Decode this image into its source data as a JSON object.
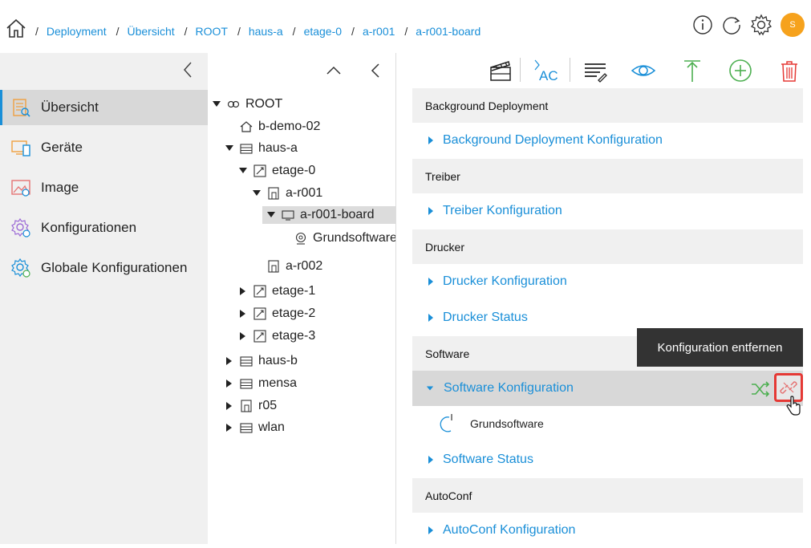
{
  "breadcrumb": [
    "Deployment",
    "Übersicht",
    "ROOT",
    "haus-a",
    "etage-0",
    "a-r001",
    "a-r001-board"
  ],
  "user": {
    "avatar_initial": "S"
  },
  "sidebar": {
    "items": [
      {
        "label": "Übersicht",
        "icon": "overview-icon",
        "active": true
      },
      {
        "label": "Geräte",
        "icon": "devices-icon"
      },
      {
        "label": "Image",
        "icon": "image-icon"
      },
      {
        "label": "Konfigurationen",
        "icon": "config-gear-icon"
      },
      {
        "label": "Globale Konfigurationen",
        "icon": "global-config-icon"
      }
    ]
  },
  "tree": {
    "nodes": [
      {
        "label": "ROOT",
        "icon": "root-icon",
        "expanded": true
      },
      {
        "label": "b-demo-02",
        "icon": "home-icon"
      },
      {
        "label": "haus-a",
        "icon": "building-icon",
        "expanded": true
      },
      {
        "label": "etage-0",
        "icon": "floor-icon",
        "expanded": true
      },
      {
        "label": "a-r001",
        "icon": "room-icon",
        "expanded": true
      },
      {
        "label": "a-r001-board",
        "icon": "board-icon",
        "expanded": true,
        "selected": true
      },
      {
        "label": "Grundsoftware",
        "icon": "software-icon"
      },
      {
        "label": "a-r002",
        "icon": "room-icon"
      },
      {
        "label": "etage-1",
        "icon": "floor-icon",
        "expanded": false
      },
      {
        "label": "etage-2",
        "icon": "floor-icon",
        "expanded": false
      },
      {
        "label": "etage-3",
        "icon": "floor-icon",
        "expanded": false
      },
      {
        "label": "haus-b",
        "icon": "building-icon",
        "expanded": false
      },
      {
        "label": "mensa",
        "icon": "building-icon",
        "expanded": false
      },
      {
        "label": "r05",
        "icon": "room-icon",
        "expanded": false
      },
      {
        "label": "wlan",
        "icon": "building-icon",
        "expanded": false
      }
    ]
  },
  "toolbar": {
    "ac_label": "AC"
  },
  "content": {
    "sections": [
      {
        "header": "Background Deployment",
        "rows": [
          "Background Deployment Konfiguration"
        ]
      },
      {
        "header": "Treiber",
        "rows": [
          "Treiber Konfiguration"
        ]
      },
      {
        "header": "Drucker",
        "rows": [
          "Drucker Konfiguration",
          "Drucker Status"
        ]
      },
      {
        "header": "Software",
        "rows": [
          "Software Konfiguration",
          "Software Status"
        ],
        "sub_item": "Grundsoftware"
      },
      {
        "header": "AutoConf",
        "rows": [
          "AutoConf Konfiguration"
        ]
      }
    ]
  },
  "tooltip": "Konfiguration entfernen",
  "colors": {
    "accent": "#1a8fd8",
    "add": "#4caf50",
    "delete": "#e53935",
    "upload": "#4caf50",
    "avatar": "#f6a21d"
  }
}
